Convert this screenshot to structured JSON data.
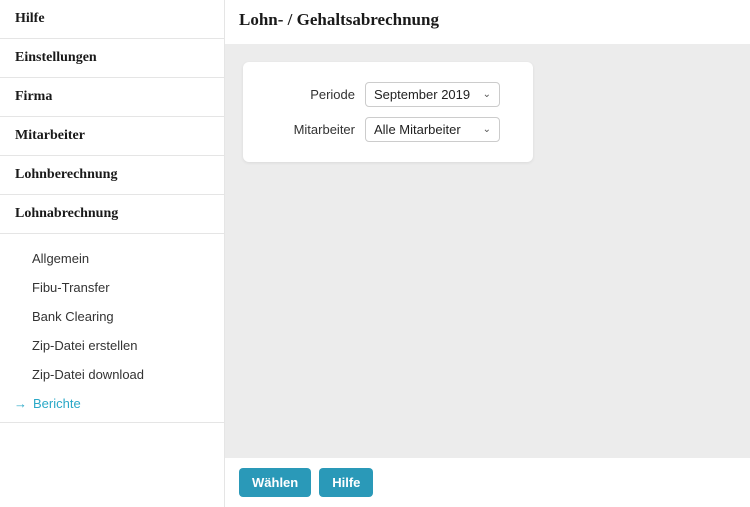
{
  "sidebar": {
    "items": [
      {
        "label": "Hilfe",
        "name": "sidebar-item-hilfe"
      },
      {
        "label": "Einstellungen",
        "name": "sidebar-item-einstellungen"
      },
      {
        "label": "Firma",
        "name": "sidebar-item-firma"
      },
      {
        "label": "Mitarbeiter",
        "name": "sidebar-item-mitarbeiter"
      },
      {
        "label": "Lohnberechnung",
        "name": "sidebar-item-lohnberechnung"
      },
      {
        "label": "Lohnabrechnung",
        "name": "sidebar-item-lohnabrechnung"
      }
    ],
    "subitems": [
      {
        "label": "Allgemein",
        "name": "sidebar-sub-allgemein",
        "active": false
      },
      {
        "label": "Fibu-Transfer",
        "name": "sidebar-sub-fibu-transfer",
        "active": false
      },
      {
        "label": "Bank Clearing",
        "name": "sidebar-sub-bank-clearing",
        "active": false
      },
      {
        "label": "Zip-Datei erstellen",
        "name": "sidebar-sub-zip-erstellen",
        "active": false
      },
      {
        "label": "Zip-Datei download",
        "name": "sidebar-sub-zip-download",
        "active": false
      },
      {
        "label": "Berichte",
        "name": "sidebar-sub-berichte",
        "active": true
      }
    ]
  },
  "header": {
    "title": "Lohn- / Gehaltsabrechnung"
  },
  "form": {
    "periode_label": "Periode",
    "periode_value": "September 2019",
    "mitarbeiter_label": "Mitarbeiter",
    "mitarbeiter_value": "Alle Mitarbeiter"
  },
  "footer": {
    "waehlen_label": "Wählen",
    "hilfe_label": "Hilfe"
  }
}
